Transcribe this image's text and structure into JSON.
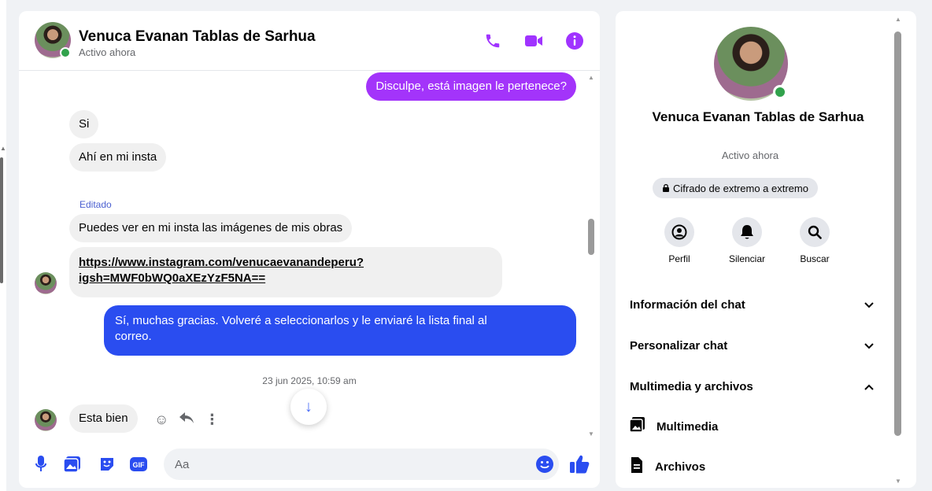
{
  "contact": {
    "name": "Venuca Evanan Tablas de Sarhua",
    "status": "Activo ahora"
  },
  "header_icons": [
    "phone-icon",
    "video-icon",
    "info-icon"
  ],
  "messages": [
    {
      "dir": "out",
      "color": "#a334fa",
      "text": "Disculpe, está imagen le pertenece?"
    },
    {
      "dir": "in",
      "text": "Si"
    },
    {
      "dir": "in",
      "text": "Ahí en mi insta"
    },
    {
      "dir": "in",
      "edited": "Editado",
      "text": "Puedes ver en mi insta las imágenes de mis obras"
    },
    {
      "dir": "in",
      "link_line1": "https://www.instagram.com/venucaevanandeperu?",
      "link_line2": "igsh=MWF0bWQ0aXEzYzF5NA=="
    },
    {
      "dir": "out",
      "color": "#2a4df0",
      "line1": "Sí, muchas gracias. Volveré a seleccionarlos y le enviaré la lista final al",
      "line2": "correo."
    },
    {
      "dir": "in",
      "text": "Esta bien"
    }
  ],
  "timestamp": "23 jun 2025, 10:59 am",
  "composer": {
    "placeholder": "Aa",
    "icons": [
      "microphone-icon",
      "image-icon",
      "sticker-icon",
      "gif-icon",
      "emoji-icon",
      "like-icon"
    ]
  },
  "info_panel": {
    "name": "Venuca Evanan Tablas de Sarhua",
    "status": "Activo ahora",
    "encryption": "Cifrado de extremo a extremo",
    "actions": [
      {
        "label": "Perfil",
        "icon": "profile-icon"
      },
      {
        "label": "Silenciar",
        "icon": "bell-icon"
      },
      {
        "label": "Buscar",
        "icon": "search-icon"
      }
    ],
    "sections": [
      {
        "label": "Información del chat",
        "expanded": false
      },
      {
        "label": "Personalizar chat",
        "expanded": false
      },
      {
        "label": "Multimedia y archivos",
        "expanded": true
      }
    ],
    "subitems": [
      {
        "label": "Multimedia",
        "icon": "media-icon"
      },
      {
        "label": "Archivos",
        "icon": "file-icon"
      }
    ]
  },
  "colors": {
    "accent_purple": "#a033ff",
    "outgoing_blue": "#2a4df0",
    "online_green": "#31a24c"
  }
}
